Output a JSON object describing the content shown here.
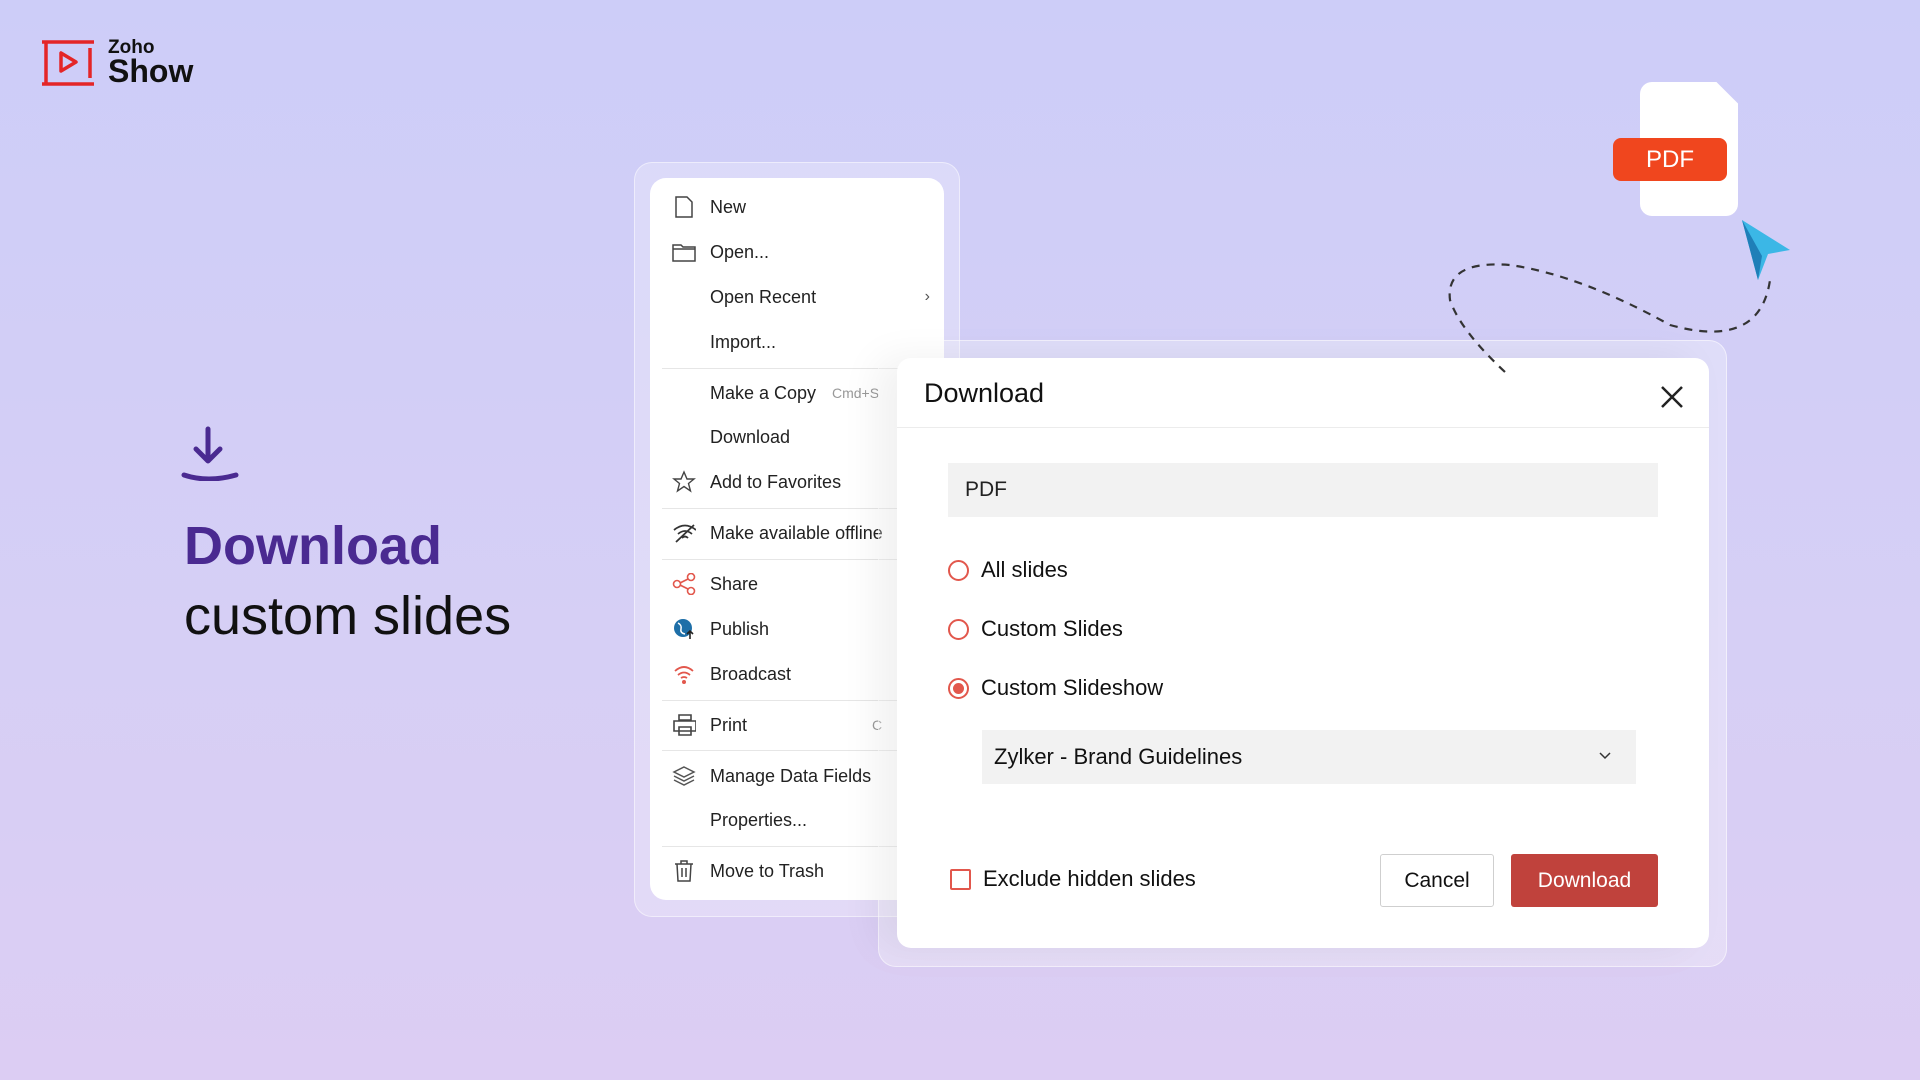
{
  "brand": {
    "line1": "Zoho",
    "line2": "Show",
    "color": "#e42527"
  },
  "hero": {
    "title": "Download",
    "subtitle": "custom slides",
    "icon": "download-icon",
    "accent": "#4a2a91"
  },
  "menu": {
    "items": [
      {
        "label": "New",
        "icon": "file-icon"
      },
      {
        "label": "Open...",
        "icon": "folder-icon"
      },
      {
        "label": "Open Recent",
        "submenu": true
      },
      {
        "label": "Import..."
      },
      {
        "label": "Make a Copy",
        "shortcut": "Cmd+S"
      },
      {
        "label": "Download"
      },
      {
        "label": "Add to Favorites",
        "icon": "star-icon"
      },
      {
        "label": "Make available offline",
        "icon": "wifi-off-icon"
      },
      {
        "label": "Share",
        "icon": "share-icon"
      },
      {
        "label": "Publish",
        "icon": "globe-icon"
      },
      {
        "label": "Broadcast",
        "icon": "broadcast-icon"
      },
      {
        "label": "Print",
        "icon": "printer-icon",
        "shortcut": "C"
      },
      {
        "label": "Manage Data Fields",
        "icon": "layers-icon"
      },
      {
        "label": "Properties..."
      },
      {
        "label": "Move to Trash",
        "icon": "trash-icon"
      }
    ]
  },
  "dialog": {
    "title": "Download",
    "format": "PDF",
    "options": [
      {
        "label": "All slides",
        "selected": false
      },
      {
        "label": "Custom Slides",
        "selected": false
      },
      {
        "label": "Custom Slideshow",
        "selected": true
      }
    ],
    "slideshow": "Zylker - Brand Guidelines",
    "exclude_hidden": {
      "label": "Exclude hidden slides",
      "checked": false
    },
    "cancel": "Cancel",
    "download": "Download",
    "accent": "#c0423c"
  },
  "pdf_badge": {
    "label": "PDF",
    "color": "#f0461e"
  },
  "cursor_color": "#3bb7e6"
}
